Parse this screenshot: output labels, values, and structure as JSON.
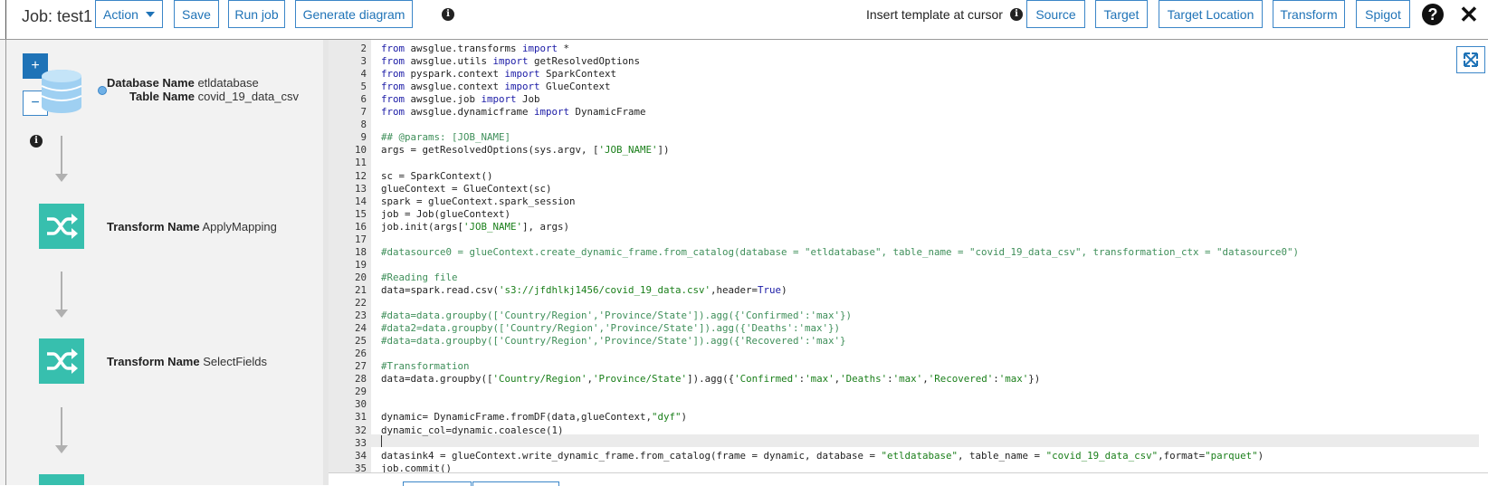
{
  "toolbar": {
    "job_title": "Job: test1",
    "action_label": "Action",
    "save_label": "Save",
    "run_job_label": "Run job",
    "generate_diagram_label": "Generate diagram",
    "insert_template_label": "Insert template at cursor",
    "source_label": "Source",
    "target_label": "Target",
    "target_location_label": "Target Location",
    "transform_label": "Transform",
    "spigot_label": "Spigot"
  },
  "icons": {
    "help": "question-circle-icon",
    "close": "close-icon",
    "info": "info-icon",
    "expand": "expand-icon",
    "database": "database-icon",
    "transform": "shuffle-icon"
  },
  "diagram": {
    "zoom_in_label": "+",
    "zoom_out_label": "−",
    "source_node": {
      "db_key": "Database Name",
      "db_value": "etldatabase",
      "table_key": "Table Name",
      "table_value": "covid_19_data_csv"
    },
    "transform_nodes": [
      {
        "key": "Transform Name",
        "value": "ApplyMapping"
      },
      {
        "key": "Transform Name",
        "value": "SelectFields"
      }
    ]
  },
  "colors": {
    "accent": "#1f73b7",
    "transform_teal": "#37bfae",
    "database_blue": "#9fd0f2"
  },
  "editor": {
    "cursor_line": "33",
    "lines": [
      {
        "n": "2",
        "parts": [
          [
            "kw",
            "from"
          ],
          [
            "t",
            " awsglue.transforms "
          ],
          [
            "kw",
            "import"
          ],
          [
            "t",
            " *"
          ]
        ]
      },
      {
        "n": "3",
        "parts": [
          [
            "kw",
            "from"
          ],
          [
            "t",
            " awsglue.utils "
          ],
          [
            "kw",
            "import"
          ],
          [
            "t",
            " getResolvedOptions"
          ]
        ]
      },
      {
        "n": "4",
        "parts": [
          [
            "kw",
            "from"
          ],
          [
            "t",
            " pyspark.context "
          ],
          [
            "kw",
            "import"
          ],
          [
            "t",
            " SparkContext"
          ]
        ]
      },
      {
        "n": "5",
        "parts": [
          [
            "kw",
            "from"
          ],
          [
            "t",
            " awsglue.context "
          ],
          [
            "kw",
            "import"
          ],
          [
            "t",
            " GlueContext"
          ]
        ]
      },
      {
        "n": "6",
        "parts": [
          [
            "kw",
            "from"
          ],
          [
            "t",
            " awsglue.job "
          ],
          [
            "kw",
            "import"
          ],
          [
            "t",
            " Job"
          ]
        ]
      },
      {
        "n": "7",
        "parts": [
          [
            "kw",
            "from"
          ],
          [
            "t",
            " awsglue.dynamicframe "
          ],
          [
            "kw",
            "import"
          ],
          [
            "t",
            " DynamicFrame"
          ]
        ]
      },
      {
        "n": "8",
        "parts": []
      },
      {
        "n": "9",
        "parts": [
          [
            "cm",
            "## @params: [JOB_NAME]"
          ]
        ]
      },
      {
        "n": "10",
        "parts": [
          [
            "t",
            "args = getResolvedOptions(sys.argv, ["
          ],
          [
            "str",
            "'JOB_NAME'"
          ],
          [
            "t",
            "])"
          ]
        ]
      },
      {
        "n": "11",
        "parts": []
      },
      {
        "n": "12",
        "parts": [
          [
            "t",
            "sc = SparkContext()"
          ]
        ]
      },
      {
        "n": "13",
        "parts": [
          [
            "t",
            "glueContext = GlueContext(sc)"
          ]
        ]
      },
      {
        "n": "14",
        "parts": [
          [
            "t",
            "spark = glueContext.spark_session"
          ]
        ]
      },
      {
        "n": "15",
        "parts": [
          [
            "t",
            "job = Job(glueContext)"
          ]
        ]
      },
      {
        "n": "16",
        "parts": [
          [
            "t",
            "job.init(args["
          ],
          [
            "str",
            "'JOB_NAME'"
          ],
          [
            "t",
            "], args)"
          ]
        ]
      },
      {
        "n": "17",
        "parts": []
      },
      {
        "n": "18",
        "parts": [
          [
            "cm",
            "#datasource0 = glueContext.create_dynamic_frame.from_catalog(database = \"etldatabase\", table_name = \"covid_19_data_csv\", transformation_ctx = \"datasource0\")"
          ]
        ]
      },
      {
        "n": "19",
        "parts": []
      },
      {
        "n": "20",
        "parts": [
          [
            "cm",
            "#Reading file"
          ]
        ]
      },
      {
        "n": "21",
        "parts": [
          [
            "t",
            "data=spark.read.csv("
          ],
          [
            "str",
            "'s3://jfdhlkj1456/covid_19_data.csv'"
          ],
          [
            "t",
            ",header="
          ],
          [
            "bi",
            "True"
          ],
          [
            "t",
            ")"
          ]
        ]
      },
      {
        "n": "22",
        "parts": []
      },
      {
        "n": "23",
        "parts": [
          [
            "cm",
            "#data=data.groupby(['Country/Region','Province/State']).agg({'Confirmed':'max'})"
          ]
        ]
      },
      {
        "n": "24",
        "parts": [
          [
            "cm",
            "#data2=data.groupby(['Country/Region','Province/State']).agg({'Deaths':'max'})"
          ]
        ]
      },
      {
        "n": "25",
        "parts": [
          [
            "cm",
            "#data=data.groupby(['Country/Region','Province/State']).agg({'Recovered':'max'}"
          ]
        ]
      },
      {
        "n": "26",
        "parts": []
      },
      {
        "n": "27",
        "parts": [
          [
            "cm",
            "#Transformation"
          ]
        ]
      },
      {
        "n": "28",
        "parts": [
          [
            "t",
            "data=data.groupby(["
          ],
          [
            "str",
            "'Country/Region'"
          ],
          [
            "t",
            ","
          ],
          [
            "str",
            "'Province/State'"
          ],
          [
            "t",
            "]).agg({"
          ],
          [
            "str",
            "'Confirmed'"
          ],
          [
            "t",
            ":"
          ],
          [
            "str",
            "'max'"
          ],
          [
            "t",
            ","
          ],
          [
            "str",
            "'Deaths'"
          ],
          [
            "t",
            ":"
          ],
          [
            "str",
            "'max'"
          ],
          [
            "t",
            ","
          ],
          [
            "str",
            "'Recovered'"
          ],
          [
            "t",
            ":"
          ],
          [
            "str",
            "'max'"
          ],
          [
            "t",
            "})"
          ]
        ]
      },
      {
        "n": "29",
        "parts": []
      },
      {
        "n": "30",
        "parts": []
      },
      {
        "n": "31",
        "parts": [
          [
            "t",
            "dynamic= DynamicFrame.fromDF(data,glueContext,"
          ],
          [
            "str",
            "\"dyf\""
          ],
          [
            "t",
            ")"
          ]
        ]
      },
      {
        "n": "32",
        "parts": [
          [
            "t",
            "dynamic_col=dynamic.coalesce(1)"
          ]
        ]
      },
      {
        "n": "33",
        "parts": []
      },
      {
        "n": "34",
        "parts": [
          [
            "t",
            "datasink4 = glueContext.write_dynamic_frame.from_catalog(frame = dynamic, database = "
          ],
          [
            "str",
            "\"etldatabase\""
          ],
          [
            "t",
            ", table_name = "
          ],
          [
            "str",
            "\"covid_19_data_csv\""
          ],
          [
            "t",
            ",format="
          ],
          [
            "str",
            "\"parquet\""
          ],
          [
            "t",
            ")"
          ]
        ]
      },
      {
        "n": "35",
        "parts": [
          [
            "t",
            "job.commit()"
          ]
        ]
      }
    ]
  }
}
